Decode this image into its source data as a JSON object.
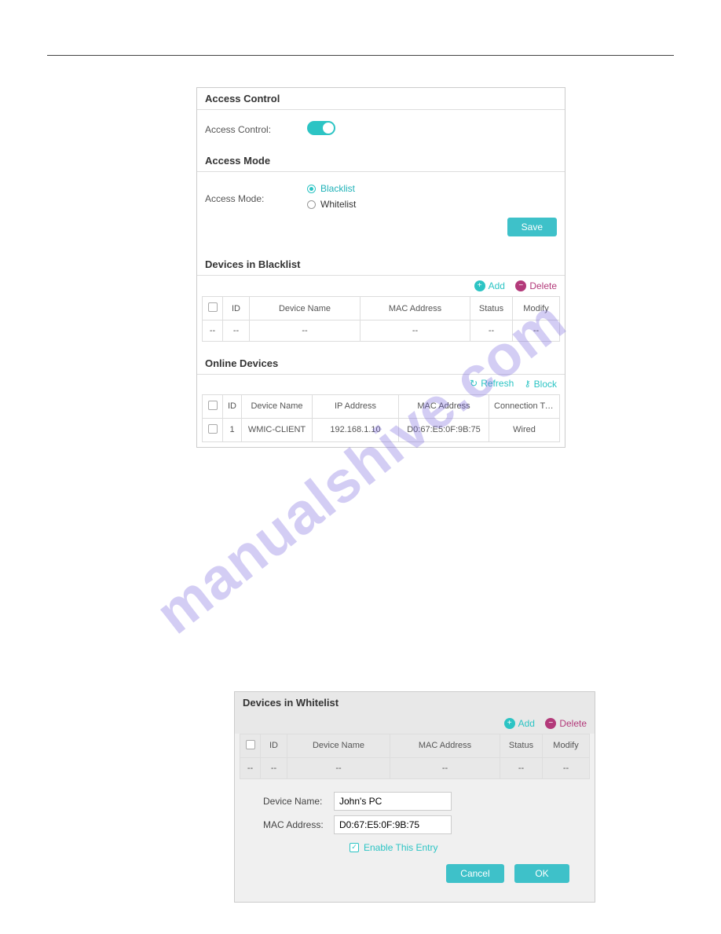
{
  "watermark": "manualshive.com",
  "panel1": {
    "accessControl": {
      "title": "Access Control",
      "label": "Access Control:"
    },
    "accessMode": {
      "title": "Access Mode",
      "label": "Access Mode:",
      "blacklist": "Blacklist",
      "whitelist": "Whitelist"
    },
    "saveBtn": "Save",
    "devicesBlacklist": {
      "title": "Devices in Blacklist",
      "add": "Add",
      "delete": "Delete",
      "columns": {
        "id": "ID",
        "deviceName": "Device Name",
        "mac": "MAC Address",
        "status": "Status",
        "modify": "Modify"
      },
      "rows": [
        {
          "chk": "--",
          "id": "--",
          "deviceName": "--",
          "mac": "--",
          "status": "--",
          "modify": "--"
        }
      ]
    },
    "onlineDevices": {
      "title": "Online Devices",
      "refresh": "Refresh",
      "block": "Block",
      "columns": {
        "id": "ID",
        "deviceName": "Device Name",
        "ip": "IP Address",
        "mac": "MAC Address",
        "connType": "Connection Type"
      },
      "rows": [
        {
          "id": "1",
          "deviceName": "WMIC-CLIENT",
          "ip": "192.168.1.10",
          "mac": "D0:67:E5:0F:9B:75",
          "connType": "Wired"
        }
      ]
    }
  },
  "panel2": {
    "title": "Devices in Whitelist",
    "add": "Add",
    "delete": "Delete",
    "columns": {
      "id": "ID",
      "deviceName": "Device Name",
      "mac": "MAC Address",
      "status": "Status",
      "modify": "Modify"
    },
    "rows": [
      {
        "chk": "--",
        "id": "--",
        "deviceName": "--",
        "mac": "--",
        "status": "--",
        "modify": "--"
      }
    ],
    "form": {
      "deviceNameLabel": "Device Name:",
      "deviceNameValue": "John's PC",
      "macLabel": "MAC Address:",
      "macValue": "D0:67:E5:0F:9B:75",
      "enable": "Enable This Entry",
      "cancel": "Cancel",
      "ok": "OK"
    }
  }
}
